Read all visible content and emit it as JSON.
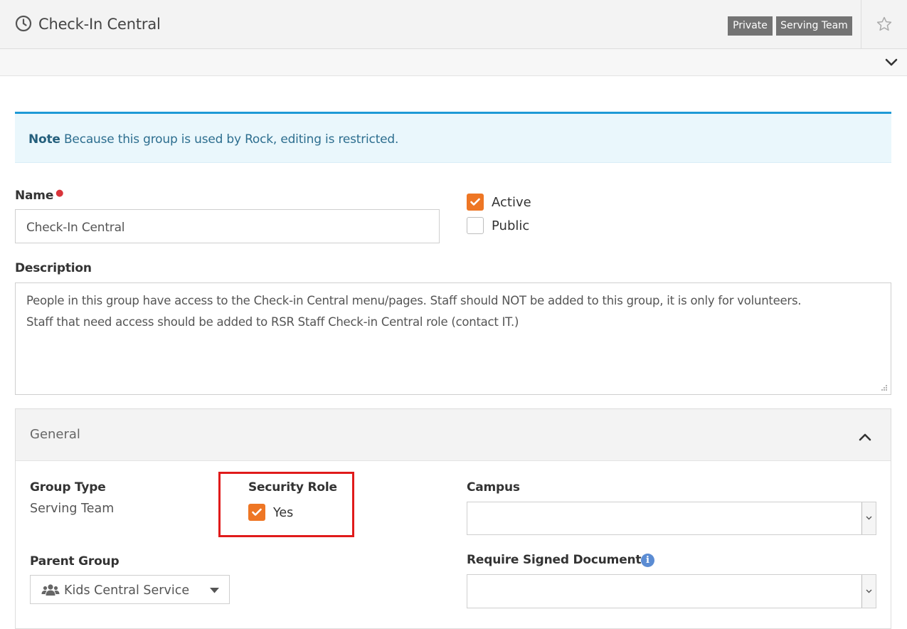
{
  "header": {
    "title": "Check-In Central",
    "badges": [
      "Private",
      "Serving Team"
    ]
  },
  "note": {
    "strong": "Note",
    "text": " Because this group is used by Rock, editing is restricted."
  },
  "form": {
    "name_label": "Name",
    "name_value": "Check-In Central",
    "active_label": "Active",
    "active_checked": true,
    "public_label": "Public",
    "public_checked": false,
    "description_label": "Description",
    "description_line1": "People in this group have access to the Check-in Central menu/pages. Staff should NOT be added to this group, it is only for volunteers.",
    "description_line2": "Staff that need access should be added to RSR Staff Check-in Central role (contact IT.)"
  },
  "general": {
    "title": "General",
    "group_type_label": "Group Type",
    "group_type_value": "Serving Team",
    "security_role_label": "Security Role",
    "security_role_value": "Yes",
    "security_role_checked": true,
    "campus_label": "Campus",
    "campus_value": "",
    "parent_group_label": "Parent Group",
    "parent_group_value": "Kids Central Service",
    "require_signed_label": "Require Signed Document",
    "require_signed_value": ""
  },
  "colors": {
    "accent_orange": "#ee7624",
    "note_border": "#1e9ad6",
    "highlight_red": "#e01b1b",
    "badge_gray": "#737373"
  },
  "icons": {
    "title": "clock-icon",
    "favorite": "star-icon",
    "collapse": "chevron-down-icon",
    "panel_toggle": "chevron-up-icon",
    "parent_group": "users-icon",
    "info": "info-icon"
  }
}
